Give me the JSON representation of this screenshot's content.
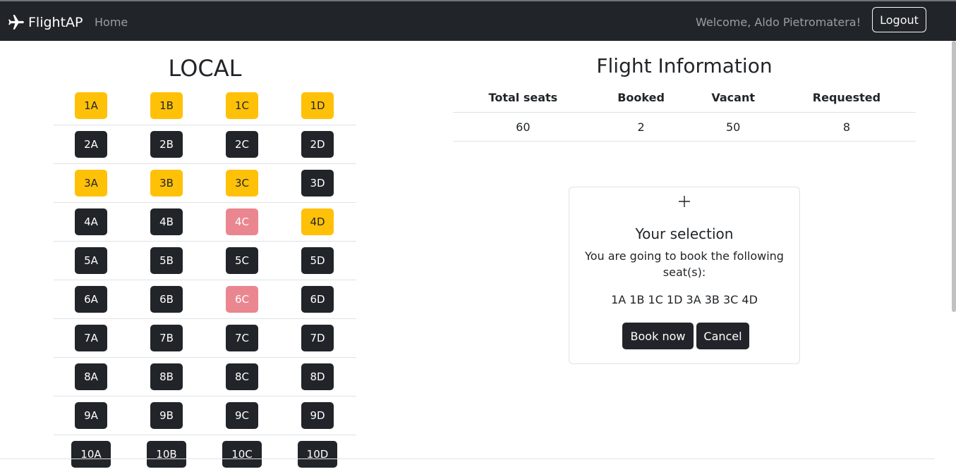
{
  "navbar": {
    "brand": "FlightAP",
    "home": "Home",
    "welcome": "Welcome, Aldo Pietromatera!",
    "logout": "Logout",
    "brand_icon": "airplane-icon"
  },
  "seat_map": {
    "title": "LOCAL",
    "rows": [
      [
        {
          "label": "1A",
          "status": "requested"
        },
        {
          "label": "1B",
          "status": "requested"
        },
        {
          "label": "1C",
          "status": "requested"
        },
        {
          "label": "1D",
          "status": "requested"
        }
      ],
      [
        {
          "label": "2A",
          "status": "vacant"
        },
        {
          "label": "2B",
          "status": "vacant"
        },
        {
          "label": "2C",
          "status": "vacant"
        },
        {
          "label": "2D",
          "status": "vacant"
        }
      ],
      [
        {
          "label": "3A",
          "status": "requested"
        },
        {
          "label": "3B",
          "status": "requested"
        },
        {
          "label": "3C",
          "status": "requested"
        },
        {
          "label": "3D",
          "status": "vacant"
        }
      ],
      [
        {
          "label": "4A",
          "status": "vacant"
        },
        {
          "label": "4B",
          "status": "vacant"
        },
        {
          "label": "4C",
          "status": "booked"
        },
        {
          "label": "4D",
          "status": "requested"
        }
      ],
      [
        {
          "label": "5A",
          "status": "vacant"
        },
        {
          "label": "5B",
          "status": "vacant"
        },
        {
          "label": "5C",
          "status": "vacant"
        },
        {
          "label": "5D",
          "status": "vacant"
        }
      ],
      [
        {
          "label": "6A",
          "status": "vacant"
        },
        {
          "label": "6B",
          "status": "vacant"
        },
        {
          "label": "6C",
          "status": "booked"
        },
        {
          "label": "6D",
          "status": "vacant"
        }
      ],
      [
        {
          "label": "7A",
          "status": "vacant"
        },
        {
          "label": "7B",
          "status": "vacant"
        },
        {
          "label": "7C",
          "status": "vacant"
        },
        {
          "label": "7D",
          "status": "vacant"
        }
      ],
      [
        {
          "label": "8A",
          "status": "vacant"
        },
        {
          "label": "8B",
          "status": "vacant"
        },
        {
          "label": "8C",
          "status": "vacant"
        },
        {
          "label": "8D",
          "status": "vacant"
        }
      ],
      [
        {
          "label": "9A",
          "status": "vacant"
        },
        {
          "label": "9B",
          "status": "vacant"
        },
        {
          "label": "9C",
          "status": "vacant"
        },
        {
          "label": "9D",
          "status": "vacant"
        }
      ],
      [
        {
          "label": "10A",
          "status": "vacant"
        },
        {
          "label": "10B",
          "status": "vacant"
        },
        {
          "label": "10C",
          "status": "vacant"
        },
        {
          "label": "10D",
          "status": "vacant"
        }
      ]
    ]
  },
  "flight_info": {
    "title": "Flight Information",
    "headers": [
      "Total seats",
      "Booked",
      "Vacant",
      "Requested"
    ],
    "values": [
      "60",
      "2",
      "50",
      "8"
    ]
  },
  "selection": {
    "icon": "plus-icon",
    "title": "Your selection",
    "text": "You are going to book the following seat(s):",
    "seats": "1A 1B 1C 1D 3A 3B 3C 4D",
    "book_label": "Book now",
    "cancel_label": "Cancel"
  },
  "colors": {
    "navbar": "#212529",
    "requested": "#ffc107",
    "booked": "#ea868f",
    "vacant": "#212529"
  }
}
